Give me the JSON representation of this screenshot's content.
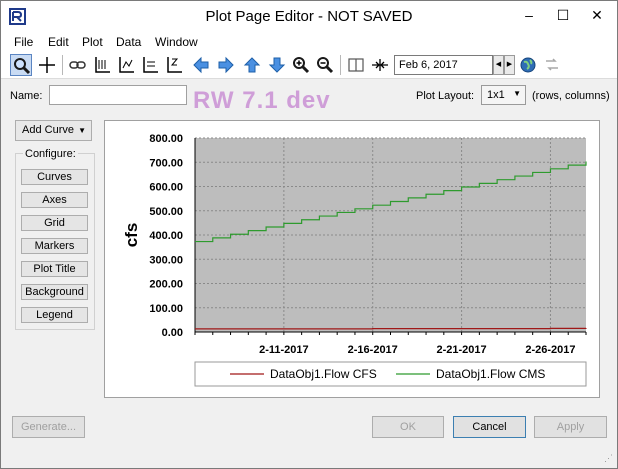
{
  "window": {
    "title": "Plot Page Editor - NOT SAVED",
    "minimize": "–",
    "maximize": "☐",
    "close": "✕"
  },
  "menu": [
    "File",
    "Edit",
    "Plot",
    "Data",
    "Window"
  ],
  "toolbar": {
    "date": "Feb 6, 2017"
  },
  "name_label": "Name:",
  "name_value": "",
  "watermark": "RW 7.1 dev",
  "plot_layout": {
    "label": "Plot Layout:",
    "value": "1x1",
    "hint": "(rows, columns)"
  },
  "add_curve_label": "Add Curve",
  "configure": {
    "label": "Configure:",
    "buttons": [
      "Curves",
      "Axes",
      "Grid",
      "Markers",
      "Plot Title",
      "Background",
      "Legend"
    ]
  },
  "footer": {
    "generate": "Generate...",
    "ok": "OK",
    "cancel": "Cancel",
    "apply": "Apply"
  },
  "chart_data": {
    "type": "line",
    "ylabel": "cfs",
    "ylim": [
      0,
      800
    ],
    "yticks": [
      "0.00",
      "100.00",
      "200.00",
      "300.00",
      "400.00",
      "500.00",
      "600.00",
      "700.00",
      "800.00"
    ],
    "xlim": [
      "2017-02-06",
      "2017-02-28"
    ],
    "xticks": [
      "2-11-2017",
      "2-16-2017",
      "2-21-2017",
      "2-26-2017"
    ],
    "grid": true,
    "legend_placement": "bottom",
    "series": [
      {
        "name": "DataObj1.Flow CFS",
        "color": "#a01818",
        "x": [
          "2017-02-06",
          "2017-02-16",
          "2017-02-26",
          "2017-02-28"
        ],
        "y": [
          13,
          14,
          15,
          16
        ]
      },
      {
        "name": "DataObj1.Flow CMS",
        "color": "#2e9b2e",
        "x": [
          "2017-02-06",
          "2017-02-07",
          "2017-02-08",
          "2017-02-09",
          "2017-02-10",
          "2017-02-11",
          "2017-02-12",
          "2017-02-13",
          "2017-02-14",
          "2017-02-15",
          "2017-02-16",
          "2017-02-17",
          "2017-02-18",
          "2017-02-19",
          "2017-02-20",
          "2017-02-21",
          "2017-02-22",
          "2017-02-23",
          "2017-02-24",
          "2017-02-25",
          "2017-02-26",
          "2017-02-27",
          "2017-02-28"
        ],
        "y": [
          373,
          388,
          403,
          418,
          433,
          448,
          463,
          478,
          493,
          508,
          523,
          538,
          553,
          568,
          583,
          598,
          613,
          628,
          643,
          658,
          673,
          688,
          703
        ]
      }
    ]
  },
  "colors": {
    "plot_bg": "#bdbdbd",
    "grid": "#8a8a8a",
    "accent": "#1f3a8a"
  }
}
